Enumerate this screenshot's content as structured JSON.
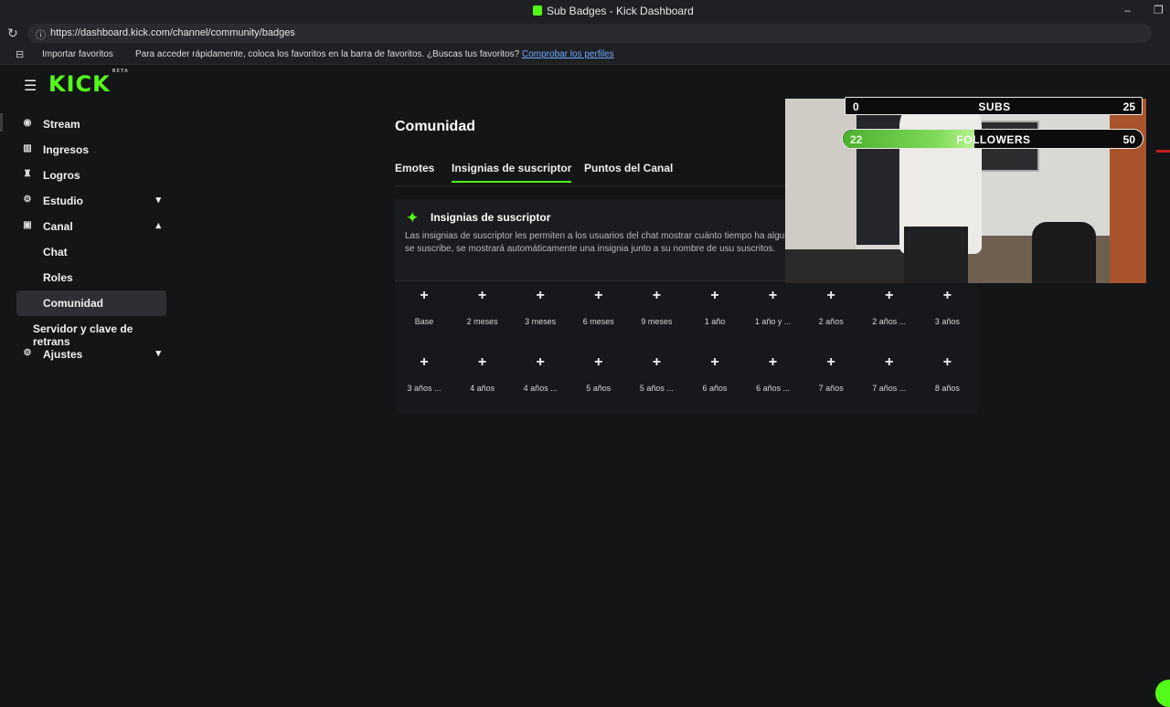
{
  "window": {
    "title": "Sub Badges - Kick Dashboard",
    "controls": [
      "–",
      "❐"
    ]
  },
  "browser": {
    "url": "https://dashboard.kick.com/channel/community/badges",
    "bookmarks": {
      "import_label": "Importar favoritos",
      "message": "Para acceder rápidamente, coloca los favoritos en la barra de favoritos. ¿Buscas tus favoritos?",
      "link": "Comprobar los perfiles"
    }
  },
  "brand": {
    "logo": "KICK",
    "beta": "BETA",
    "accent": "#53fc18"
  },
  "sidebar": {
    "items": [
      {
        "label": "Stream",
        "icon": "broadcast-icon",
        "glyph": "((•))"
      },
      {
        "label": "Ingresos",
        "icon": "chart-icon",
        "glyph": "▥"
      },
      {
        "label": "Logros",
        "icon": "trophy-icon",
        "glyph": "🏆"
      },
      {
        "label": "Estudio",
        "icon": "sliders-icon",
        "glyph": "⚙",
        "chevron": "▾"
      },
      {
        "label": "Canal",
        "icon": "channel-icon",
        "glyph": "⚑",
        "chevron": "▴"
      }
    ],
    "sub_items": [
      "Chat",
      "Roles",
      "Comunidad"
    ],
    "server_item": "Servidor y clave de retrans",
    "settings_item": {
      "label": "Ajustes",
      "glyph": "⚙",
      "chevron": "▾"
    }
  },
  "main": {
    "title": "Comunidad",
    "tabs": [
      "Emotes",
      "Insignias de suscriptor",
      "Puntos del Canal"
    ],
    "card": {
      "title": "Insignias de suscriptor",
      "description": "Las insignias de suscriptor les permiten a los usuarios del chat mostrar cuánto tiempo ha alguien se suscribe, se mostrará automáticamente una insignia junto a su nombre de usu suscritos."
    },
    "badges_row1": [
      "Base",
      "2 meses",
      "3 meses",
      "6 meses",
      "9 meses",
      "1 año",
      "1 año y ...",
      "2 años",
      "2 años ...",
      "3 años"
    ],
    "badges_row2": [
      "3 años ...",
      "4 años",
      "4 años ...",
      "5 años",
      "5 años ...",
      "6 años",
      "6 años ...",
      "7 años",
      "7 años ...",
      "8 años"
    ]
  },
  "overlay": {
    "subs": {
      "current": "0",
      "label": "SUBS",
      "goal": "25"
    },
    "followers": {
      "current": "22",
      "label": "FOLLOWERS",
      "goal": "50",
      "progress": 0.44
    }
  }
}
